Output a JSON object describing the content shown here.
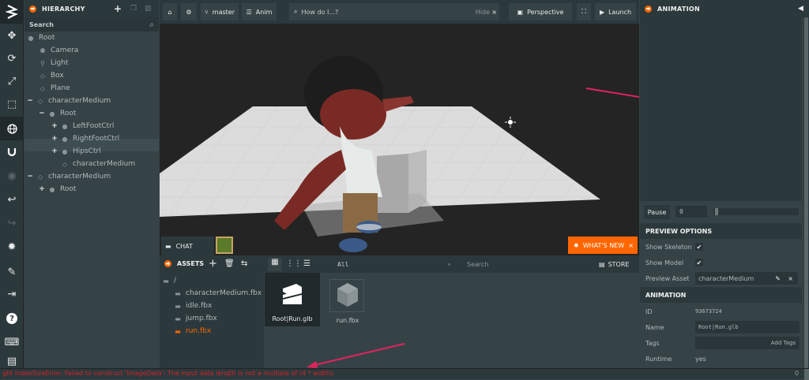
{
  "hierarchy": {
    "title": "HIERARCHY",
    "search_label": "Search",
    "nodes": [
      {
        "label": "Root"
      },
      {
        "label": "Camera"
      },
      {
        "label": "Light"
      },
      {
        "label": "Box"
      },
      {
        "label": "Plane"
      },
      {
        "label": "characterMedium"
      },
      {
        "label": "Root"
      },
      {
        "label": "LeftFootCtrl"
      },
      {
        "label": "RightFootCtrl"
      },
      {
        "label": "HipsCtrl"
      },
      {
        "label": "characterMedium"
      },
      {
        "label": "characterMedium"
      },
      {
        "label": "Root"
      }
    ]
  },
  "topbar": {
    "branch": "master",
    "anim": "Anim",
    "search_placeholder": "How do I...?",
    "hide": "Hide",
    "camera": "Perspective",
    "launch": "Launch"
  },
  "viewport": {
    "chat": "CHAT",
    "whats_new": "WHAT'S NEW"
  },
  "assets": {
    "title": "ASSETS",
    "filter": "All",
    "search_placeholder": "Search",
    "store": "STORE",
    "root": "/",
    "folders": [
      {
        "label": "characterMedium.fbx",
        "active": false
      },
      {
        "label": "idle.fbx",
        "active": false
      },
      {
        "label": "jump.fbx",
        "active": false
      },
      {
        "label": "run.fbx",
        "active": true
      }
    ],
    "items": [
      {
        "label": "Root|Run.glb"
      },
      {
        "label": "run.fbx"
      }
    ]
  },
  "animation_panel": {
    "title": "ANIMATION",
    "pause": "Pause",
    "time": "0",
    "preview_options_title": "PREVIEW OPTIONS",
    "show_skeleton": "Show Skeleton",
    "show_model": "Show Model",
    "preview_asset_label": "Preview Asset",
    "preview_asset_value": "characterMedium",
    "animation_title": "ANIMATION",
    "id_label": "ID",
    "id_value": "93673724",
    "name_label": "Name",
    "name_value": "Root|Run.glb",
    "tags_label": "Tags",
    "add_tags": "Add Tags",
    "runtime_label": "Runtime",
    "runtime_value": "yes"
  },
  "status": {
    "error": "ght IndexSizeError: Failed to construct 'ImageData': The input data length is not a multiple of (4 * width).",
    "count": "0"
  },
  "colors": {
    "accent": "#ff6600",
    "error": "#d2232a",
    "annotation_arrow": "#e0245e"
  }
}
